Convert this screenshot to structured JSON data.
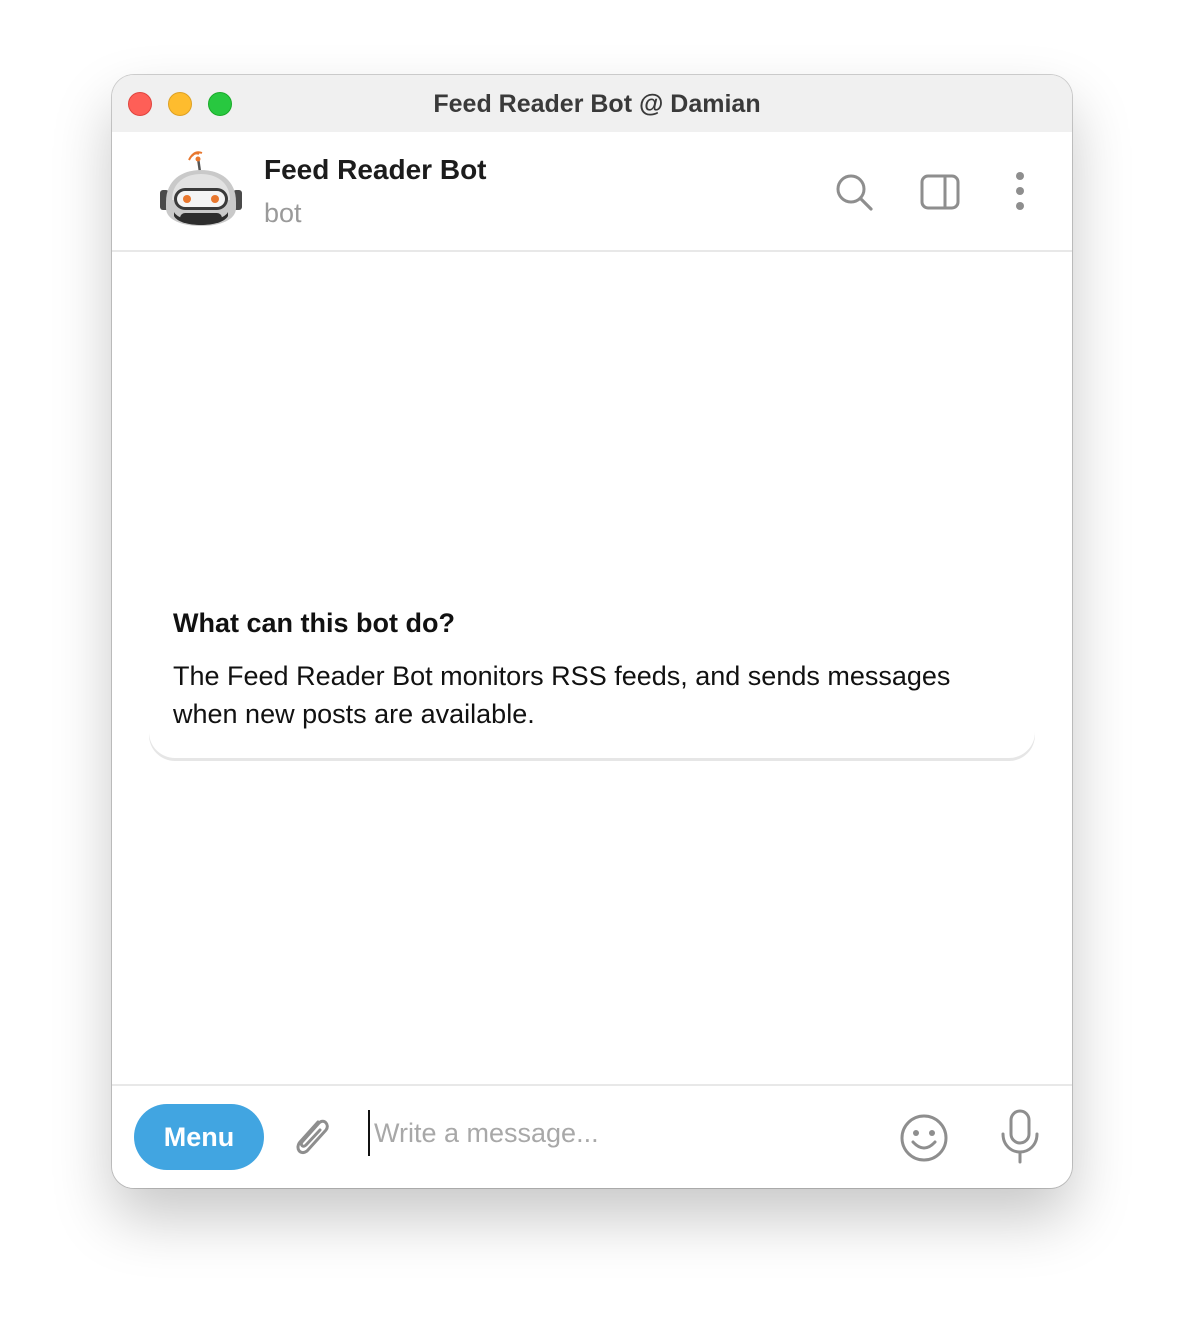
{
  "window": {
    "title": "Feed Reader Bot @ Damian"
  },
  "header": {
    "name": "Feed Reader Bot",
    "status": "bot",
    "avatar_icon": "robot-avatar-icon",
    "actions": [
      "search-icon",
      "sidebar-toggle-icon",
      "more-vertical-icon"
    ]
  },
  "bot_info": {
    "title": "What can this bot do?",
    "description": "The Feed Reader Bot monitors RSS feeds, and sends messages when new posts are available."
  },
  "composer": {
    "menu_label": "Menu",
    "placeholder": "Write a message...",
    "value": "",
    "icons": [
      "paperclip-icon",
      "emoji-icon",
      "microphone-icon"
    ]
  },
  "colors": {
    "accent": "#41a5e1",
    "close": "#fe5f57",
    "minimize": "#febc2e",
    "zoom": "#28c840"
  }
}
